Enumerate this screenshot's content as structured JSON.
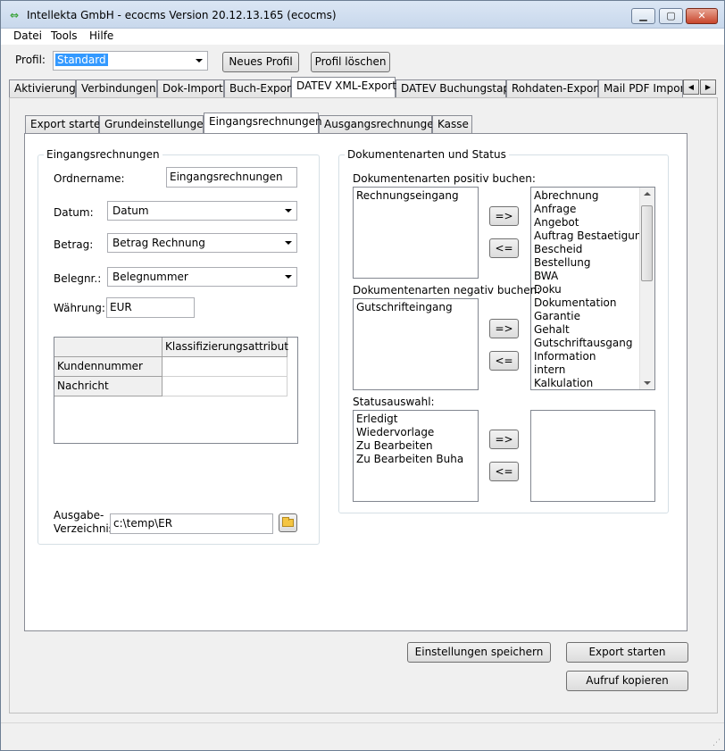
{
  "window": {
    "title": "Intellekta GmbH - ecocms Version 20.12.13.165 (ecocms)",
    "min": "▁",
    "max": "▢",
    "close": "✕"
  },
  "menu": [
    "Datei",
    "Tools",
    "Hilfe"
  ],
  "profile": {
    "label": "Profil:",
    "value": "Standard",
    "new_button": "Neues Profil",
    "delete_button": "Profil löschen"
  },
  "main_tabs": [
    "Aktivierung",
    "Verbindungen",
    "Dok-Import",
    "Buch-Export",
    "DATEV XML-Export",
    "DATEV Buchungstapel",
    "Rohdaten-Export",
    "Mail PDF Import"
  ],
  "main_tab_active": "DATEV XML-Export",
  "sub_tabs": [
    "Export starten",
    "Grundeinstellungen",
    "Eingangsrechnungen",
    "Ausgangsrechnungen",
    "Kasse"
  ],
  "sub_tab_active": "Eingangsrechnungen",
  "left_group": {
    "title": "Eingangsrechnungen",
    "ordnername_label": "Ordnername:",
    "ordnername_value": "Eingangsrechnungen",
    "datum_label": "Datum:",
    "datum_value": "Datum",
    "betrag_label": "Betrag:",
    "betrag_value": "Betrag Rechnung",
    "belegnr_label": "Belegnr.:",
    "belegnr_value": "Belegnummer",
    "waehrung_label": "Währung:",
    "waehrung_value": "EUR",
    "grid_header": "Klassifizierungsattribut",
    "grid_rows": [
      "Kundennummer",
      "Nachricht"
    ],
    "ausgabe_label_1": "Ausgabe-",
    "ausgabe_label_2": "Verzeichnis",
    "ausgabe_value": "c:\\temp\\ER"
  },
  "right_group": {
    "title": "Dokumentenarten und Status",
    "positiv_label": "Dokumentenarten positiv buchen:",
    "positiv_items": [
      "Rechnungseingang"
    ],
    "negativ_label": "Dokumentenarten negativ buchen:",
    "negativ_items": [
      "Gutschrifteingang"
    ],
    "available_items": [
      "Abrechnung",
      "Anfrage",
      "Angebot",
      "Auftrag Bestaetigung",
      "Bescheid",
      "Bestellung",
      "BWA",
      "Doku",
      "Dokumentation",
      "Garantie",
      "Gehalt",
      "Gutschriftausgang",
      "Information",
      "intern",
      "Kalkulation"
    ],
    "status_label": "Statusauswahl:",
    "status_items": [
      "Erledigt",
      "Wiedervorlage",
      "Zu Bearbeiten",
      "Zu Bearbeiten Buha"
    ],
    "add_btn": "=>",
    "remove_btn": "<="
  },
  "footer": {
    "save_button": "Einstellungen speichern",
    "export_button": "Export starten",
    "copy_button": "Aufruf kopieren"
  }
}
